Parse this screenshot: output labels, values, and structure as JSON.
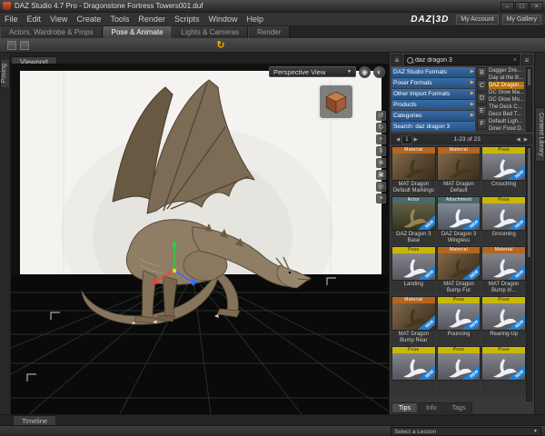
{
  "window": {
    "title": "DAZ Studio 4.7 Pro - Dragonstone Fortress Towers001.duf"
  },
  "icons": {
    "minimize": "–",
    "maximize": "□",
    "close": "×",
    "dropdown": "▼",
    "arrow_right": "▶",
    "arrow_left": "◀",
    "menu": "≡",
    "clear": "×",
    "undo": "↻",
    "new_badge": "NEW"
  },
  "menu": {
    "items": [
      "File",
      "Edit",
      "View",
      "Create",
      "Tools",
      "Render",
      "Scripts",
      "Window",
      "Help"
    ]
  },
  "header": {
    "logo": "DAZ|3D",
    "my_account": "My Account",
    "my_gallery": "My Gallery"
  },
  "activity_tabs": [
    {
      "label": "Actors, Wardrobe & Props"
    },
    {
      "label": "Pose & Animate"
    },
    {
      "label": "Lights & Cameras"
    },
    {
      "label": "Render"
    }
  ],
  "side_tabs": {
    "left": "Posing",
    "right": "Content Library"
  },
  "viewport": {
    "tab": "Viewport",
    "camera": "Perspective View",
    "eyes": [
      {
        "name": "eye",
        "glyph": "◉"
      },
      {
        "name": "drawstyle",
        "glyph": "◐"
      }
    ],
    "tools": [
      {
        "name": "orbit",
        "glyph": "↺"
      },
      {
        "name": "rotate",
        "glyph": "↻"
      },
      {
        "name": "pan",
        "glyph": "+"
      },
      {
        "name": "dolly",
        "glyph": "⇕"
      },
      {
        "name": "zoom",
        "glyph": "⊕"
      },
      {
        "name": "frame",
        "glyph": "▣"
      },
      {
        "name": "aim",
        "glyph": "◎"
      },
      {
        "name": "options",
        "glyph": "≡"
      }
    ]
  },
  "smart_content": {
    "search": "daz dragon 3",
    "categories": [
      "DAZ Studio Formats",
      "Poser Formats",
      "Other Import Formats",
      "Products",
      "Categories"
    ],
    "search_row": "Search: daz dragon 3",
    "letters": [
      "B",
      "C",
      "D",
      "E",
      "F"
    ],
    "products": [
      "Dagger Dre...",
      "Day at the B...",
      "DAZ Dragon...",
      "DC Glow Ma...",
      "DC Glow Mo...",
      "The Deck C...",
      "Deco Bed T...",
      "Default Ligh...",
      "Diner Food D..."
    ],
    "pagination": {
      "page": "1",
      "range": "1-23 of 23"
    },
    "thumbnails": [
      {
        "label": "MAT Dragon Default Markings",
        "banner": "Material",
        "new": false
      },
      {
        "label": "MAT Dragon Default",
        "banner": "Material",
        "new": false
      },
      {
        "label": "Crouching",
        "banner": "Pose",
        "new": true
      },
      {
        "label": "DAZ Dragon 3 Base",
        "banner": "Actor",
        "new": true
      },
      {
        "label": "DAZ Dragon 3 Wingless",
        "banner": "Attachment",
        "new": true
      },
      {
        "label": "Grooming",
        "banner": "Pose",
        "new": true
      },
      {
        "label": "Landing",
        "banner": "Pose",
        "new": true
      },
      {
        "label": "MAT Dragon Bump Fur",
        "banner": "Material",
        "new": true
      },
      {
        "label": "MAT Dragon Bump Iri...",
        "banner": "Material",
        "new": true
      },
      {
        "label": "MAT Dragon Bump Rear",
        "banner": "Material",
        "new": true
      },
      {
        "label": "Pouncing",
        "banner": "Pose",
        "new": true
      },
      {
        "label": "Rearing-Up",
        "banner": "Pose",
        "new": true
      },
      {
        "label": "",
        "banner": "Pose",
        "new": true
      },
      {
        "label": "",
        "banner": "Pose",
        "new": true
      },
      {
        "label": "",
        "banner": "Pose",
        "new": true
      }
    ],
    "footer_tabs": [
      "Tips",
      "Info",
      "Tags"
    ]
  },
  "bottom": {
    "timeline": "Timeline",
    "lesson": "Select a Lesson"
  },
  "colors": {
    "accent_orange": "#c87820",
    "banner_pose": "#c9b800",
    "banner_material": "#b5651d",
    "banner_actor": "#4a6a6a",
    "highlight_blue": "#2f5e96",
    "new_badge": "#1f7fd4"
  }
}
